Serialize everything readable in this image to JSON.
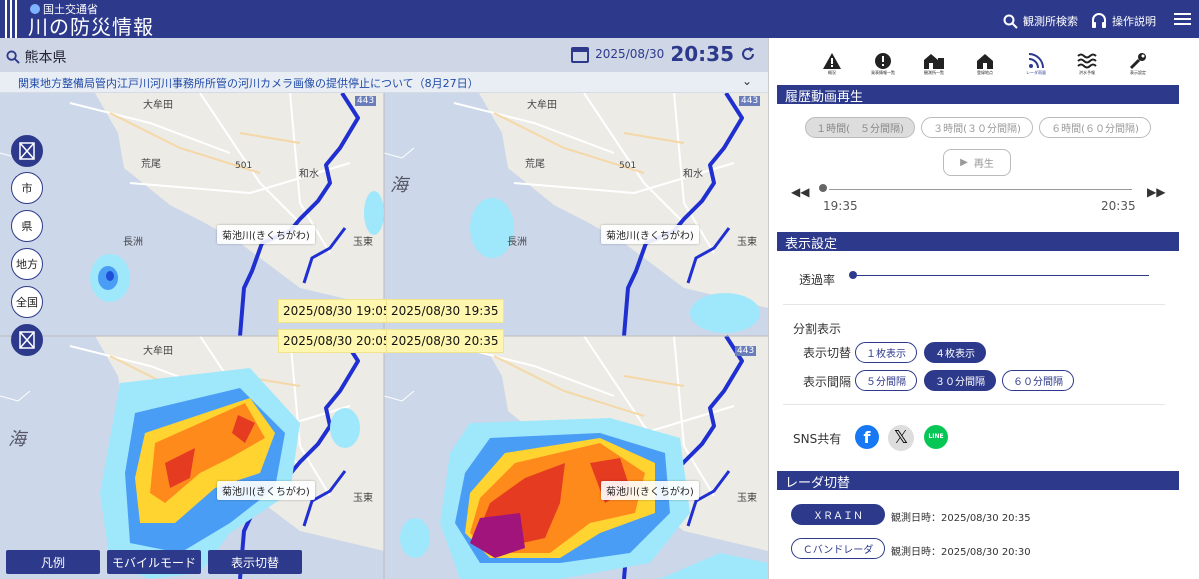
{
  "header": {
    "ministry": "国土交通省",
    "title": "川の防災情報",
    "station_search": "観測所検索",
    "help": "操作説明"
  },
  "mapbar": {
    "prefecture": "熊本県",
    "date": "2025/08/30",
    "time": "20:35"
  },
  "notice": "関東地方整備局管内江戸川河川事務所所管の河川カメラ画像の提供停止について（8月27日）",
  "map": {
    "river_label": "菊池川(きくちがわ)",
    "sea_label": "海",
    "place_labels": {
      "omuta": "大牟田",
      "arao": "荒尾",
      "nagasu": "長洲",
      "tamana_higashi": "玉東",
      "nagomi": "和水",
      "route443": "443",
      "route501": "501"
    },
    "timestamps": [
      "2025/08/30 19:05",
      "2025/08/30 19:35",
      "2025/08/30 20:05",
      "2025/08/30 20:35"
    ],
    "scale_buttons": [
      "市",
      "県",
      "地方",
      "全国"
    ]
  },
  "bottom_buttons": [
    "凡例",
    "モバイルモード",
    "表示切替"
  ],
  "side": {
    "icons": [
      {
        "name": "warning-icon",
        "label": "概況"
      },
      {
        "name": "alert-icon",
        "label": "発表情報一覧"
      },
      {
        "name": "building-icon",
        "label": "観測所一覧"
      },
      {
        "name": "home-icon",
        "label": "登録地点"
      },
      {
        "name": "rss-icon",
        "label": "レーダ雨量"
      },
      {
        "name": "wave-icon",
        "label": "洪水予報"
      },
      {
        "name": "wrench-icon",
        "label": "表示設定"
      }
    ],
    "history": {
      "header": "履歴動画再生",
      "options": [
        "１時間(　５分間隔)",
        "３時間(３０分間隔)",
        "６時間(６０分間隔)"
      ],
      "play": "再生",
      "start": "19:35",
      "end": "20:35"
    },
    "display": {
      "header": "表示設定",
      "opacity": "透過率",
      "split": "分割表示",
      "switch_label": "表示切替",
      "switch_options": [
        "１枚表示",
        "４枚表示"
      ],
      "interval_label": "表示間隔",
      "interval_options": [
        "５分間隔",
        "３０分間隔",
        "６０分間隔"
      ],
      "sns": "SNS共有"
    },
    "radar": {
      "header": "レーダ切替",
      "xrain": "ＸＲＡＩＮ",
      "xrain_time": "観測日時：2025/08/30 20:35",
      "cband": "Ｃバンドレーダ",
      "cband_time": "観測日時：2025/08/30 20:30"
    }
  },
  "colors": {
    "brand": "#2d3a8c",
    "river": "#1f2fd0",
    "sea": "#cdd9ee",
    "rain_light": "#9fe8fb",
    "rain_blue": "#4a9df4",
    "rain_deep": "#1d4fd8",
    "rain_yellow": "#ffd431",
    "rain_orange": "#ff8a1c",
    "rain_red": "#e43b21",
    "rain_purple": "#a0147b"
  }
}
